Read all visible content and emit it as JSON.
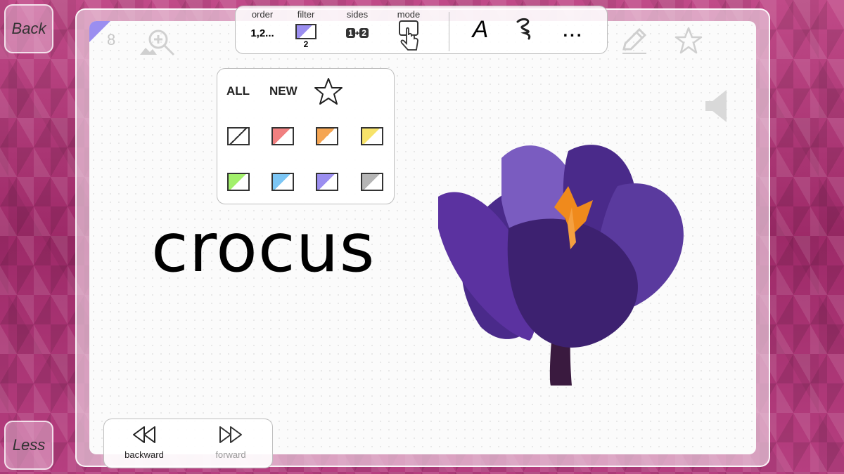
{
  "side_buttons": {
    "back_label": "Back",
    "less_label": "Less"
  },
  "card": {
    "page_number": "8",
    "word": "crocus",
    "icons": [
      "zoom-in-icon",
      "pencil-icon",
      "star-icon",
      "speaker-icon",
      "crocus-flower-image"
    ]
  },
  "toolbar": {
    "order": {
      "label": "order",
      "value": "1,2..."
    },
    "filter": {
      "label": "filter",
      "value": "2"
    },
    "sides": {
      "label": "sides",
      "value_a": "1",
      "plus": "+",
      "value_b": "2"
    },
    "mode": {
      "label": "mode"
    },
    "font_glyph": "A",
    "handwriting_glyph": "?",
    "more_glyph": "..."
  },
  "filter_panel": {
    "all_label": "ALL",
    "new_label": "NEW",
    "swatches": [
      {
        "name": "none",
        "color": "#ffffff"
      },
      {
        "name": "red",
        "color": "#f08080"
      },
      {
        "name": "orange",
        "color": "#f5a552"
      },
      {
        "name": "yellow",
        "color": "#f7e36a"
      },
      {
        "name": "green",
        "color": "#a2f06b"
      },
      {
        "name": "blue",
        "color": "#7cc6f5"
      },
      {
        "name": "purple",
        "color": "#9b8ef0"
      },
      {
        "name": "gray",
        "color": "#b5b5b5"
      }
    ]
  },
  "nav": {
    "backward_label": "backward",
    "forward_label": "forward"
  },
  "colors": {
    "accent": "#9b8ef0",
    "background": "#a8306f"
  }
}
